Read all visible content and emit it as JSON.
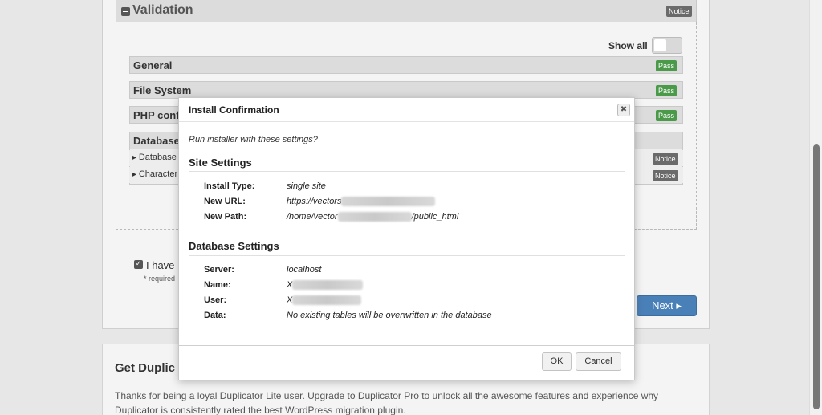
{
  "validation": {
    "title": "Validation",
    "status_badge": "Notice",
    "show_all_label": "Show all",
    "checks": [
      {
        "label": "General",
        "status": "Pass"
      },
      {
        "label": "File System",
        "status": "Pass"
      },
      {
        "label": "PHP conf",
        "status": "Pass"
      }
    ],
    "database": {
      "label": "Database",
      "items": [
        {
          "label": "Database",
          "status": "Notice"
        },
        {
          "label": "Character",
          "status": "Notice"
        }
      ]
    }
  },
  "accept": {
    "label": "I have",
    "required_note": "* required"
  },
  "next_button": "Next ▸",
  "promo": {
    "title": "Get Duplic",
    "text": "Thanks for being a loyal Duplicator Lite user. Upgrade to Duplicator Pro to unlock all the awesome features and experience why Duplicator is consistently rated the best WordPress migration plugin."
  },
  "dialog": {
    "title": "Install Confirmation",
    "close_icon": "close-icon",
    "question": "Run installer with these settings?",
    "site_settings": {
      "heading": "Site Settings",
      "rows": [
        {
          "label": "Install Type:",
          "value": "single site"
        },
        {
          "label": "New URL:",
          "value": "https://vectors"
        },
        {
          "label": "New Path:",
          "value_prefix": "/home/vector",
          "value_suffix": "/public_html"
        }
      ]
    },
    "database_settings": {
      "heading": "Database Settings",
      "rows": [
        {
          "label": "Server:",
          "value": "localhost"
        },
        {
          "label": "Name:",
          "value": "X"
        },
        {
          "label": "User:",
          "value": "X"
        },
        {
          "label": "Data:",
          "value": "No existing tables will be overwritten in the database"
        }
      ]
    },
    "ok_button": "OK",
    "cancel_button": "Cancel"
  },
  "colors": {
    "pass": "#4a9a4a",
    "notice": "#6a6a6a",
    "next": "#4a80b8"
  }
}
